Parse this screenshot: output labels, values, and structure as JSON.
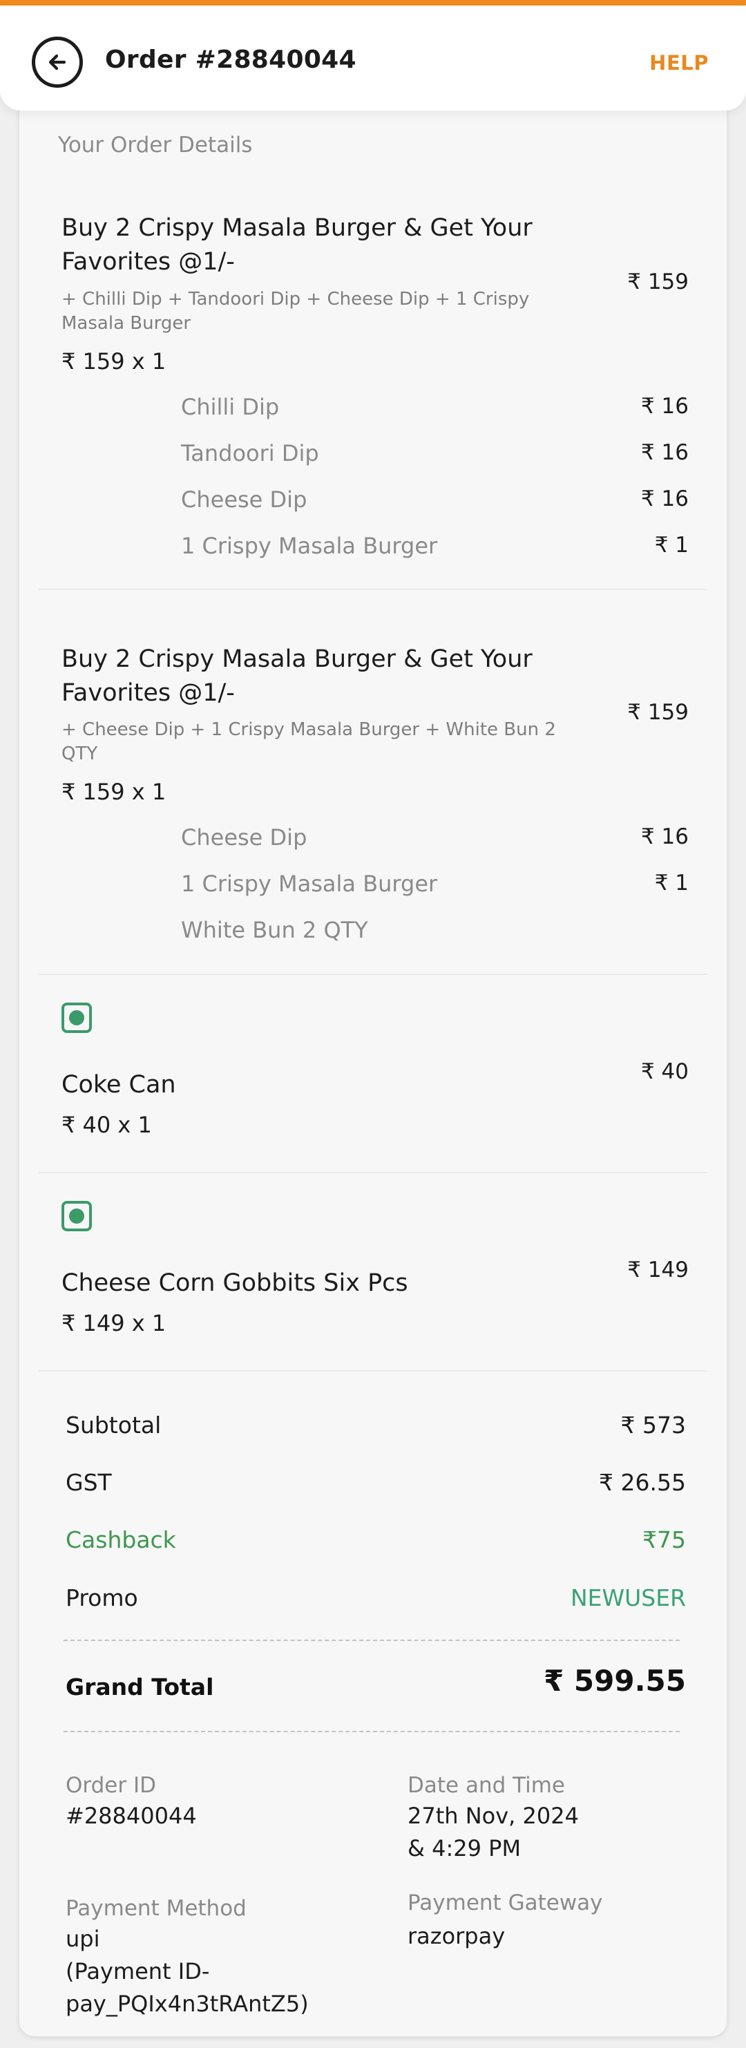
{
  "header": {
    "title": "Order #28840044",
    "help_label": "HELP",
    "accent_color": "#f08a1d",
    "back_icon": "back-arrow-icon"
  },
  "order_details": {
    "section_title": "Your Order Details",
    "items": [
      {
        "title": "Buy 2 Crispy Masala Burger & Get Your Favorites @1/-",
        "subtitle": "+ Chilli Dip + Tandoori Dip + Cheese Dip + 1 Crispy Masala Burger",
        "qty": "₹ 159 x 1",
        "price": "₹ 159",
        "addons": [
          {
            "name": "Chilli Dip",
            "price": "₹ 16"
          },
          {
            "name": "Tandoori Dip",
            "price": "₹ 16"
          },
          {
            "name": "Cheese Dip",
            "price": "₹ 16"
          },
          {
            "name": "1 Crispy Masala Burger",
            "price": "₹ 1"
          }
        ]
      },
      {
        "title": "Buy 2 Crispy Masala Burger & Get Your Favorites @1/-",
        "subtitle": "+ Cheese Dip + 1 Crispy Masala Burger + White Bun 2 QTY",
        "qty": "₹ 159 x 1",
        "price": "₹ 159",
        "addons": [
          {
            "name": "Cheese Dip",
            "price": "₹ 16"
          },
          {
            "name": "1 Crispy Masala Burger",
            "price": "₹ 1"
          },
          {
            "name": "White Bun 2 QTY",
            "price": ""
          }
        ]
      },
      {
        "title": "Coke Can",
        "qty": "₹ 40 x 1",
        "price": "₹ 40",
        "icon": "veg-indicator-icon"
      },
      {
        "title": "Cheese Corn Gobbits Six Pcs",
        "qty": "₹ 149 x 1",
        "price": "₹ 149",
        "icon": "veg-indicator-icon"
      }
    ]
  },
  "summary": {
    "subtotal_label": "Subtotal",
    "subtotal_value": "₹ 573",
    "gst_label": "GST",
    "gst_value": "₹ 26.55",
    "cashback_label": "Cashback",
    "cashback_value": "₹75",
    "promo_label": "Promo",
    "promo_value": "NEWUSER",
    "grand_total_label": "Grand Total",
    "grand_total_value": "₹ 599.55",
    "cashback_color": "#3f9650",
    "promo_color": "#3aa276"
  },
  "meta": {
    "order_id_label": "Order ID",
    "order_id_value": "#28840044",
    "datetime_label": "Date and Time",
    "datetime_line1": "27th Nov, 2024",
    "datetime_line2": "& 4:29 PM",
    "payment_method_label": "Payment Method",
    "payment_method_line1": "upi",
    "payment_method_line2": "(Payment ID-",
    "payment_method_line3": "pay_PQIx4n3tRAntZ5)",
    "payment_gateway_label": "Payment Gateway",
    "payment_gateway_value": "razorpay"
  }
}
